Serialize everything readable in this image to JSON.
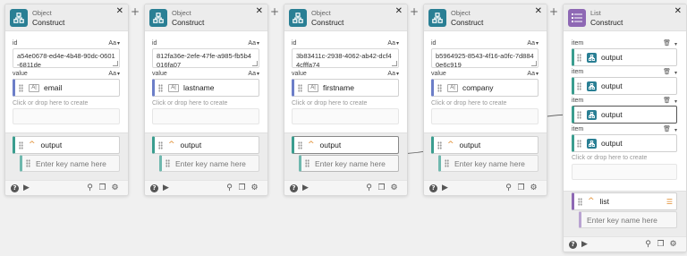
{
  "nodes": [
    {
      "category": "Object",
      "title": "Construct",
      "id_label": "id",
      "id_value": "a54e0678-ed4e-4b48-90dc-0601-6811de",
      "value_label": "value",
      "aa_label": "Aa",
      "field_value": "email",
      "drop_hint": "Click or drop here to create",
      "output_label": "output",
      "key_placeholder": "Enter key name here"
    },
    {
      "category": "Object",
      "title": "Construct",
      "id_label": "id",
      "id_value": "812fa36e-2efe-47fe-a985-fb5b4016fa07",
      "value_label": "value",
      "aa_label": "Aa",
      "field_value": "lastname",
      "drop_hint": "Click or drop here to create",
      "output_label": "output",
      "key_placeholder": "Enter key name here"
    },
    {
      "category": "Object",
      "title": "Construct",
      "id_label": "id",
      "id_value": "3b83411c-2938-4062-ab42-dcf44cfffa74",
      "value_label": "value",
      "aa_label": "Aa",
      "field_value": "firstname",
      "drop_hint": "Click or drop here to create",
      "output_label": "output",
      "key_placeholder": "Enter key name here"
    },
    {
      "category": "Object",
      "title": "Construct",
      "id_label": "id",
      "id_value": "b5964925-8543-4f16-a0fc-7d8840e6c919",
      "value_label": "value",
      "aa_label": "Aa",
      "field_value": "company",
      "drop_hint": "Click or drop here to create",
      "output_label": "output",
      "key_placeholder": "Enter key name here"
    }
  ],
  "list_node": {
    "category": "List",
    "title": "Construct",
    "item_label": "item",
    "items": [
      "output",
      "output",
      "output",
      "output"
    ],
    "drop_hint": "Click or drop here to create",
    "output_label": "list",
    "key_placeholder": "Enter key name here"
  },
  "glyphs": {
    "close": "✕",
    "plus": "+",
    "help": "?",
    "play": "▶",
    "search": "⚲",
    "copy": "❐",
    "settings": "⚙",
    "chevron_up": "^",
    "trash": "🗑",
    "caret": "▾",
    "list_lines": "☰",
    "type_text": "A|"
  },
  "colors": {
    "object_accent": "#2a7f94",
    "list_accent": "#8e68b4",
    "chevron": "#e08a2a"
  }
}
